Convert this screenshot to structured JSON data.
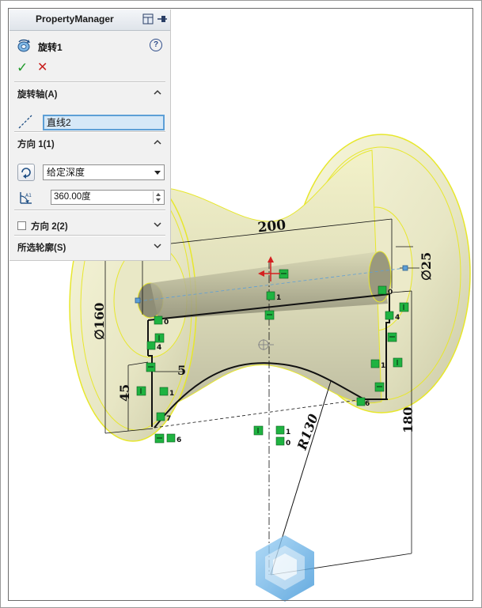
{
  "panel": {
    "header_title": "PropertyManager",
    "header_icons": [
      "pin-panel-icon",
      "push-pin-icon"
    ],
    "feature_title": "旋转1",
    "help_label": "?",
    "ok_label": "✓",
    "cancel_label": "✕"
  },
  "sections": {
    "axis": {
      "title": "旋转轴(A)",
      "field_value": "直线2"
    },
    "direction1": {
      "title": "方向 1(1)",
      "end_condition": "给定深度",
      "angle_value": "360.00度"
    },
    "direction2": {
      "title": "方向 2(2)",
      "checked": false
    },
    "contours": {
      "title": "所选轮廓(S)"
    }
  },
  "sketch": {
    "dimensions": {
      "length": "200",
      "diameter_small": "∅25",
      "diameter_large": "∅160",
      "offset_5": "5",
      "height_45": "45",
      "height_180": "180",
      "radius": "R130"
    },
    "relation_labels": [
      "0",
      "0",
      "4",
      "4",
      "7",
      "1",
      "1",
      "1",
      "6",
      "6",
      "1",
      "0"
    ]
  },
  "colors": {
    "part_body": "#f2f0c6",
    "part_edge": "#e8e82a",
    "sketch_line": "#111111",
    "relation_green": "#1fb341",
    "axis_blue": "#5d9fd6"
  }
}
